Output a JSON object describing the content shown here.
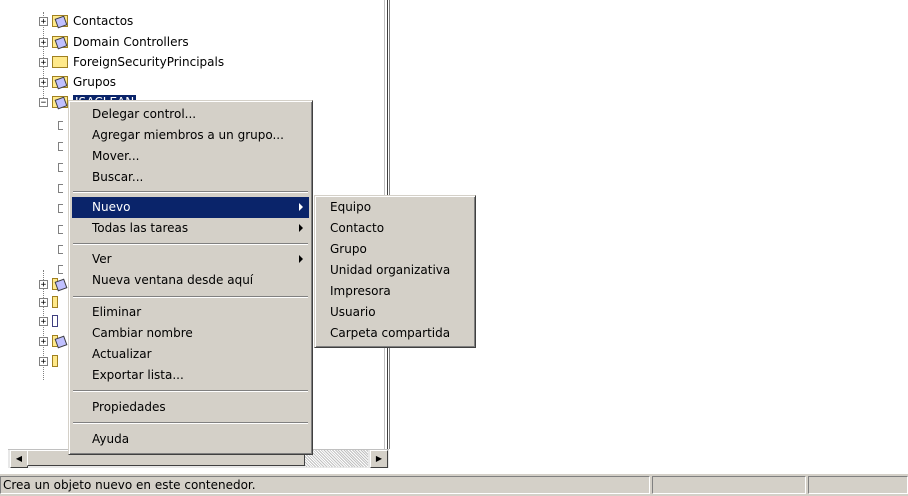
{
  "tree": {
    "items": [
      {
        "label": "Contactos",
        "expander": "+"
      },
      {
        "label": "Domain Controllers",
        "expander": "+"
      },
      {
        "label": "ForeignSecurityPrincipals",
        "expander": "+"
      },
      {
        "label": "Grupos",
        "expander": "+"
      },
      {
        "label": "ISACLEAN",
        "expander": "−"
      }
    ],
    "partial_expanders": [
      "+",
      "+",
      "+",
      "+",
      "+"
    ]
  },
  "context_menu": {
    "items": [
      {
        "label": "Delegar control..."
      },
      {
        "label": "Agregar miembros a un grupo..."
      },
      {
        "label": "Mover..."
      },
      {
        "label": "Buscar..."
      },
      {
        "label": "Nuevo"
      },
      {
        "label": "Todas las tareas"
      },
      {
        "label": "Ver"
      },
      {
        "label": "Nueva ventana desde aquí"
      },
      {
        "label": "Eliminar"
      },
      {
        "label": "Cambiar nombre"
      },
      {
        "label": "Actualizar"
      },
      {
        "label": "Exportar lista..."
      },
      {
        "label": "Propiedades"
      },
      {
        "label": "Ayuda"
      }
    ]
  },
  "submenu": {
    "items": [
      {
        "label": "Equipo"
      },
      {
        "label": "Contacto"
      },
      {
        "label": "Grupo"
      },
      {
        "label": "Unidad organizativa"
      },
      {
        "label": "Impresora"
      },
      {
        "label": "Usuario"
      },
      {
        "label": "Carpeta compartida"
      }
    ]
  },
  "statusbar": {
    "text": "Crea un objeto nuevo en este contenedor."
  },
  "colors": {
    "highlight": "#0a246a",
    "menu_bg": "#d4d0c8"
  }
}
